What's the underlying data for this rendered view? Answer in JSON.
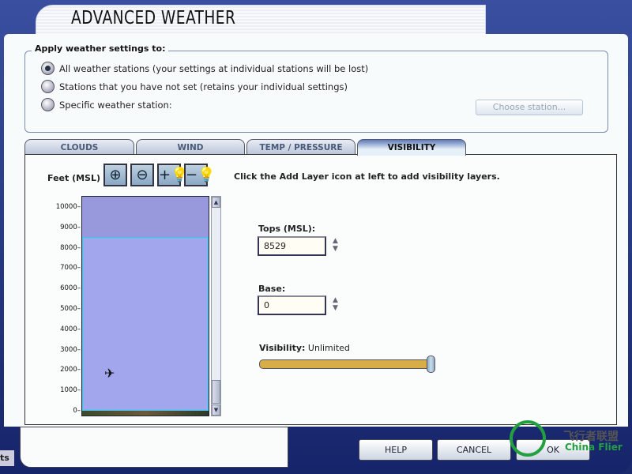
{
  "window": {
    "title": "ADVANCED WEATHER"
  },
  "apply_group": {
    "legend": "Apply weather settings to:",
    "options": [
      {
        "label": "All weather stations (your settings at individual stations will be lost)",
        "selected": true
      },
      {
        "label": "Stations that you have not set (retains your individual settings)",
        "selected": false
      },
      {
        "label": "Specific weather station:",
        "selected": false
      }
    ],
    "choose_station": "Choose station..."
  },
  "tabs": [
    {
      "label": "CLOUDS",
      "active": false
    },
    {
      "label": "WIND",
      "active": false
    },
    {
      "label": "TEMP / PRESSURE",
      "active": false
    },
    {
      "label": "VISIBILITY",
      "active": true
    }
  ],
  "visibility": {
    "axis_label": "Feet (MSL)",
    "toolbar_icons": [
      "zoom-in-icon",
      "zoom-out-icon",
      "add-layer-icon",
      "remove-layer-icon"
    ],
    "hint": "Click the Add Layer icon at left to add visibility layers.",
    "altitude_ticks": [
      "10000",
      "9000",
      "8000",
      "7000",
      "6000",
      "5000",
      "4000",
      "3000",
      "2000",
      "1000",
      "0"
    ],
    "layer": {
      "tops": 8529,
      "base": 0
    },
    "tops_label": "Tops (MSL):",
    "tops_value": "8529",
    "base_label": "Base:",
    "base_value": "0",
    "visibility_label": "Visibility:",
    "visibility_value": "Unlimited",
    "slider_percent": 100
  },
  "buttons": {
    "help": "HELP",
    "cancel": "CANCEL",
    "ok": "OK"
  },
  "side_text": "ts",
  "watermark": {
    "cn": "飞行者联盟",
    "en": "China Flier",
    "color": "#22a040"
  }
}
